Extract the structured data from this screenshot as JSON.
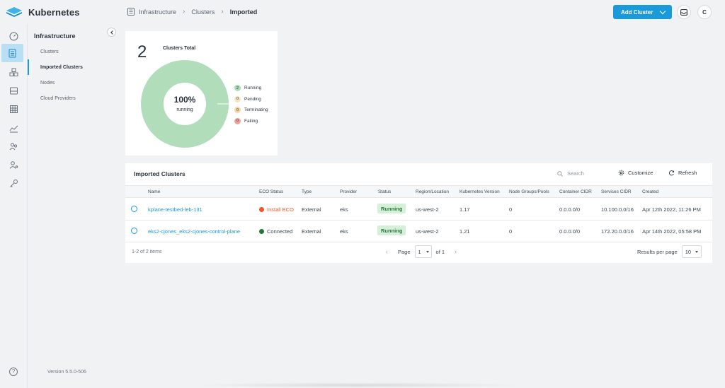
{
  "app": {
    "title": "Kubernetes"
  },
  "breadcrumb": [
    "Infrastructure",
    "Clusters",
    "Imported"
  ],
  "header": {
    "add_button_label": "Add Cluster",
    "avatar_initial": "C"
  },
  "rail": {
    "icons": [
      "dashboard-icon",
      "infrastructure-icon",
      "apps-icon",
      "storage-icon",
      "catalog-icon",
      "metrics-icon",
      "users-icon",
      "user-settings-icon",
      "key-icon"
    ],
    "active_index": 1
  },
  "subnav": {
    "title": "Infrastructure",
    "items": [
      {
        "label": "Clusters"
      },
      {
        "label": "Imported Clusters"
      },
      {
        "label": "Nodes"
      },
      {
        "label": "Cloud Providers"
      }
    ],
    "active_index": 1,
    "version": "Version 5.5.0-506"
  },
  "summary": {
    "total": "2",
    "total_label": "Clusters Total",
    "donut_percent": "100%",
    "donut_label": "running",
    "running_fraction": 1.0,
    "legend": [
      {
        "count": "2",
        "label": "Running",
        "color": "#a9dbb5"
      },
      {
        "count": "0",
        "label": "Pending",
        "color": "#f3e4c2"
      },
      {
        "count": "0",
        "label": "Terminating",
        "color": "#f6d6a6"
      },
      {
        "count": "0",
        "label": "Failing",
        "color": "#f1a39b"
      }
    ],
    "donut_color": "#b1ddbb"
  },
  "table": {
    "title": "Imported Clusters",
    "search_placeholder": "Search",
    "customize_label": "Customize",
    "refresh_label": "Refresh",
    "columns": [
      "Name",
      "ECO Status",
      "Type",
      "Provider",
      "Status",
      "Region/Location",
      "Kubernetes Version",
      "Node Groups/Pools",
      "Container CIDR",
      "Services CIDR",
      "Created"
    ],
    "rows": [
      {
        "name": "kplane-testbed-leb-131",
        "eco_status": "Install ECO",
        "eco_color": "#f0552b",
        "type": "External",
        "provider": "eks",
        "status": "Running",
        "region": "us-west-2",
        "k8s_version": "1.17",
        "node_groups": "0",
        "container_cidr": "0.0.0.0/0",
        "services_cidr": "10.100.0.0/16",
        "created": "Apr 12th 2022, 11:26 PM"
      },
      {
        "name": "eks2-cjones_eks2-cjones-control-plane",
        "eco_status": "Connected",
        "eco_color": "#1f7a3a",
        "type": "External",
        "provider": "eks",
        "status": "Running",
        "region": "us-west-2",
        "k8s_version": "1.21",
        "node_groups": "0",
        "container_cidr": "0.0.0.0/0",
        "services_cidr": "172.20.0.0/16",
        "created": "Apr 14th 2022, 05:58 PM"
      }
    ],
    "items_count": "1-2 of 2 items",
    "page_label": "Page",
    "page_value": "1",
    "page_of": "of 1",
    "rpp_label": "Results per page",
    "rpp_value": "10"
  }
}
